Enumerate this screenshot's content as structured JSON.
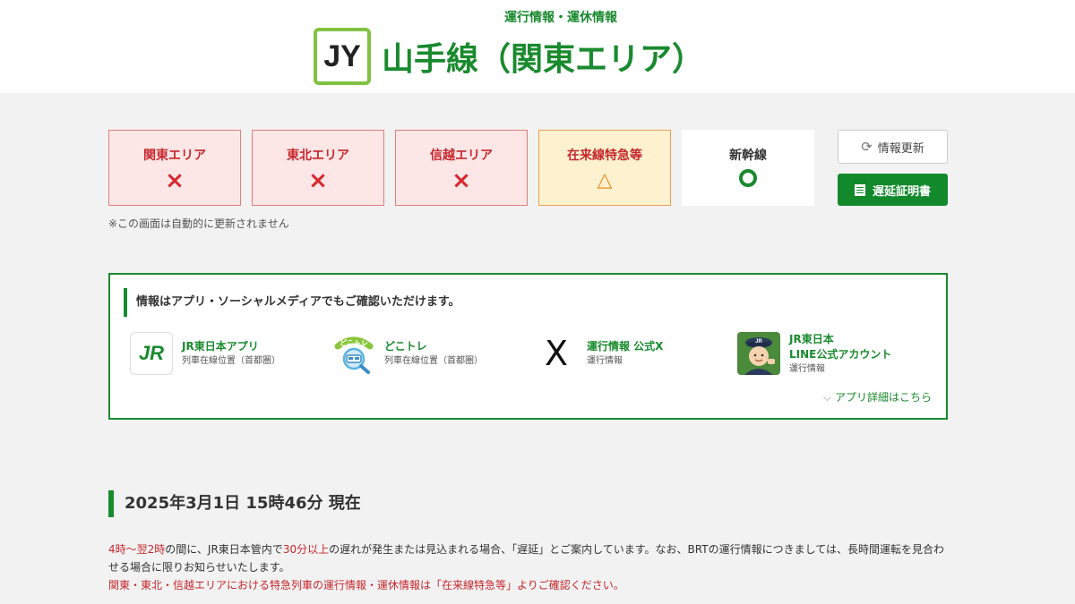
{
  "header": {
    "subtitle": "運行情報・運休情報",
    "line_code": "JY",
    "line_title": "山手線（関東エリア）"
  },
  "areas": [
    {
      "label": "関東エリア",
      "status": "×",
      "kind": "alert"
    },
    {
      "label": "東北エリア",
      "status": "×",
      "kind": "alert"
    },
    {
      "label": "信越エリア",
      "status": "×",
      "kind": "alert"
    },
    {
      "label": "在来線特急等",
      "status": "△",
      "kind": "warn"
    },
    {
      "label": "新幹線",
      "status": "○",
      "kind": "ok"
    }
  ],
  "buttons": {
    "refresh": "情報更新",
    "certificate": "遅延証明書"
  },
  "note": "※この画面は自動的に更新されません",
  "apps": {
    "heading": "情報はアプリ・ソーシャルメディアでもご確認いただけます。",
    "items": [
      {
        "name": "JR東日本アプリ",
        "desc": "列車在線位置（首都圏）",
        "icon_logo": "JR"
      },
      {
        "name": "どこトレ",
        "desc": "列車在線位置（首都圏）",
        "icon_logo": "どこトレ"
      },
      {
        "name": "運行情報 公式X",
        "desc": "運行情報",
        "icon_logo": "X"
      },
      {
        "name_line1": "JR東日本",
        "name_line2": "LINE公式アカウント",
        "desc": "運行情報",
        "icon_logo": "JR"
      }
    ],
    "more": "アプリ詳細はこちら"
  },
  "status_time": "2025年3月1日 15時46分 現在",
  "info": {
    "p1_red_a": "4時〜翌2時",
    "p1_a": "の間に、JR東日本管内で",
    "p1_red_b": "30分以上",
    "p1_b": "の遅れが発生または見込まれる場合、「遅延」とご案内しています。なお、BRTの運行情報につきましては、長時間運転を見合わせる場合に限りお知らせいたします。",
    "p2_red": "関東・東北・信越エリアにおける特急列車の運行情報・運休情報は「在来線特急等」よりご確認ください。"
  },
  "colors": {
    "brand_green": "#1a8a2e",
    "line_green": "#80c241",
    "alert_red": "#d8262e",
    "warn_orange": "#e88b1a"
  }
}
